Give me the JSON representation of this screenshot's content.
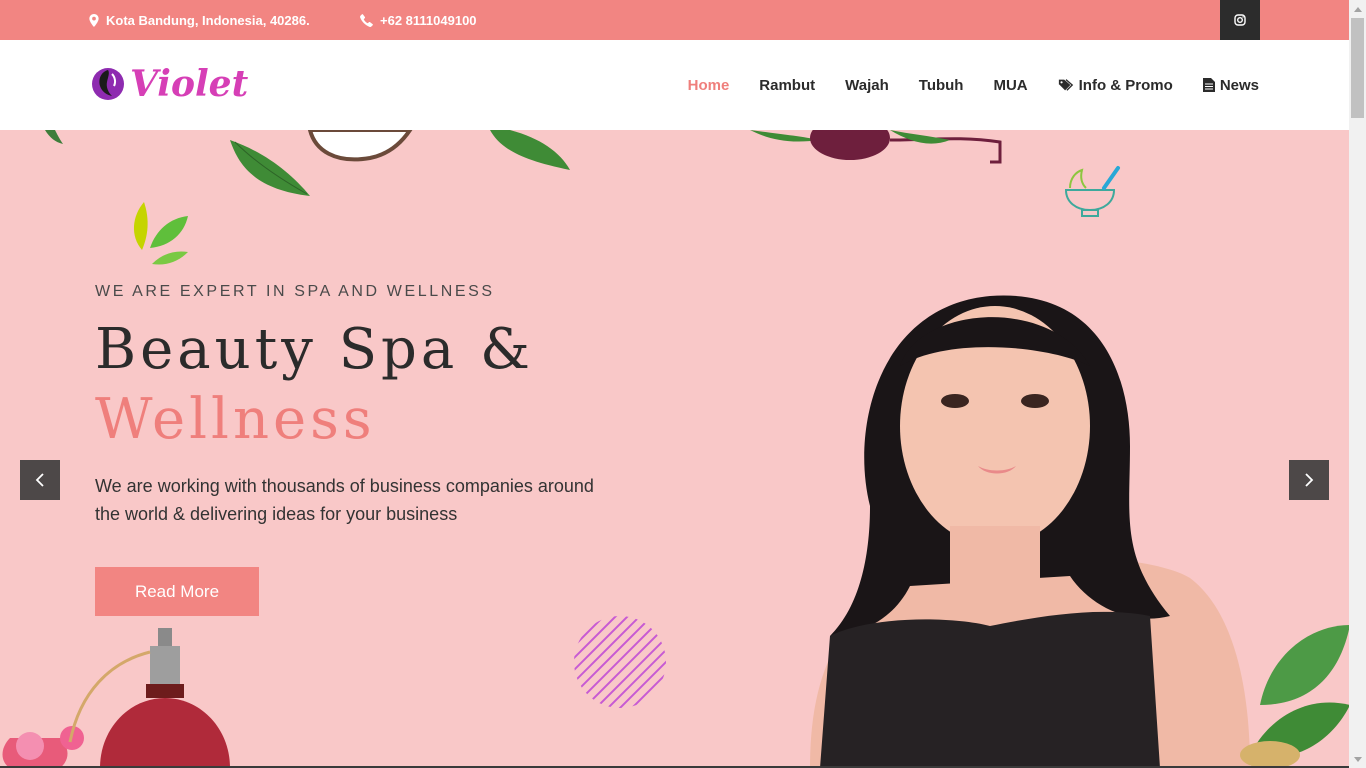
{
  "topbar": {
    "location": "Kota Bandung, Indonesia, 40286.",
    "phone": "+62 8111049100",
    "social_icon": "instagram-icon"
  },
  "header": {
    "logo_text": "Violet",
    "nav": [
      {
        "label": "Home",
        "active": true
      },
      {
        "label": "Rambut",
        "active": false
      },
      {
        "label": "Wajah",
        "active": false
      },
      {
        "label": "Tubuh",
        "active": false
      },
      {
        "label": "MUA",
        "active": false
      },
      {
        "label": "Info & Promo",
        "icon": "tag-icon",
        "active": false
      },
      {
        "label": "News",
        "icon": "document-icon",
        "active": false
      }
    ]
  },
  "hero": {
    "subtitle": "WE ARE EXPERT IN SPA AND WELLNESS",
    "title_line1": "Beauty Spa &",
    "title_line2": "Wellness",
    "description": "We are working with thousands of business companies around the world & delivering ideas for your business",
    "button_label": "Read More",
    "prev_icon": "chevron-left-icon",
    "next_icon": "chevron-right-icon"
  },
  "colors": {
    "topbar": "#f28582",
    "accent": "#ef7f7c",
    "hero_bg": "#f9c8c8",
    "logo": "#d63fb6"
  }
}
